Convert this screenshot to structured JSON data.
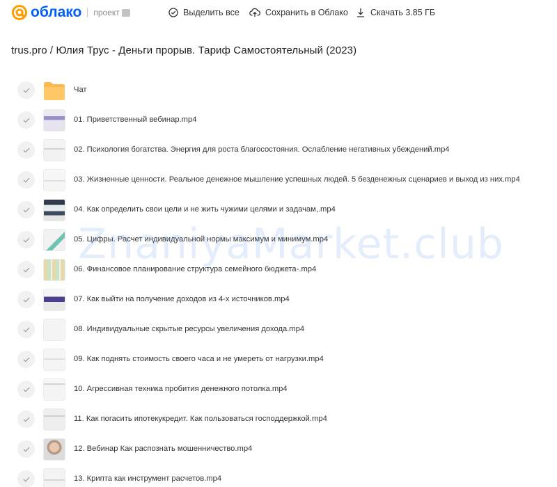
{
  "header": {
    "logo_text": "облако",
    "logo_sub": "проект",
    "actions": {
      "select_all": "Выделить все",
      "save_to_cloud": "Сохранить в Облако",
      "download": "Скачать 3.85 ГБ"
    }
  },
  "folder": {
    "title": "trus.pro / Юлия Трус - Деньги прорыв. Тариф Самостоятельный (2023)"
  },
  "items": [
    {
      "name": "Чат",
      "type": "folder"
    },
    {
      "name": "01. Приветственный вебинар.mp4",
      "type": "video"
    },
    {
      "name": "02. Психология богатства. Энергия для роста благосостояния. Ослабление негативных убеждений.mp4",
      "type": "video"
    },
    {
      "name": "03. Жизненные ценности. Реальное денежное мышление успешных людей. 5 безденежных сценариев и выход из них.mp4",
      "type": "video"
    },
    {
      "name": "04. Как определить свои цели и не жить чужими целями и задачам,.mp4",
      "type": "video"
    },
    {
      "name": "05. Цифры. Расчет индивидуальной нормы максимум и минимум.mp4",
      "type": "video"
    },
    {
      "name": "06. Финансовое планирование структура семейного бюджета-.mp4",
      "type": "video"
    },
    {
      "name": "07. Как выйти на получение доходов из 4-х источников.mp4",
      "type": "video"
    },
    {
      "name": "08. Индивидуальные скрытые ресурсы увеличения дохода.mp4",
      "type": "video"
    },
    {
      "name": "09. Как поднять стоимость своего часа и не умереть от нагрузки.mp4",
      "type": "video"
    },
    {
      "name": "10. Агрессивная техника пробития денежного потолка.mp4",
      "type": "video"
    },
    {
      "name": "11. Как погасить ипотекукредит. Как пользоваться господдержкой.mp4",
      "type": "video"
    },
    {
      "name": "12. Вебинар Как распознать мошенничество.mp4",
      "type": "video"
    },
    {
      "name": "13. Крипта как инструмент расчетов.mp4",
      "type": "video"
    }
  ],
  "watermark": "ZnaniyaMarket.club",
  "colors": {
    "brand": "#005ff9",
    "brand_orange": "#ff9e00",
    "folder": "#ffb84d"
  }
}
